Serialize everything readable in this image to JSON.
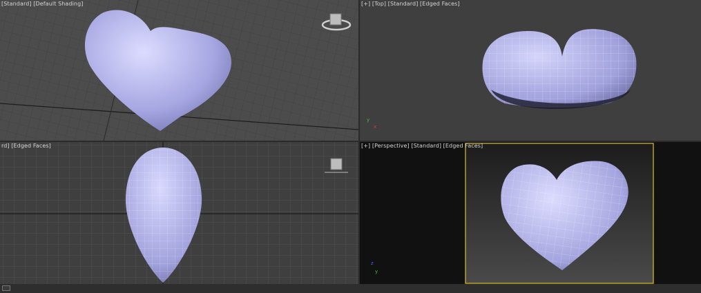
{
  "viewports": {
    "top_left": {
      "label": "[Standard] [Default Shading]"
    },
    "top_right": {
      "label": "[+] [Top] [Standard] [Edged Faces]"
    },
    "bottom_left": {
      "label": "rd] [Edged Faces]"
    },
    "bottom_right": {
      "label": "[+] [Perspective] [Standard] [Edged Faces]"
    }
  },
  "axes": {
    "x": "x",
    "y": "y",
    "z": "z"
  },
  "colors": {
    "mesh": "#a9a9e6",
    "wire": "#ffffff",
    "active_border": "#e0c020"
  }
}
